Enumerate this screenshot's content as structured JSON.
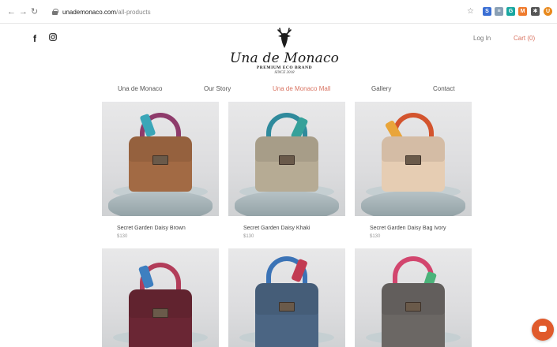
{
  "browser": {
    "url_host": "unademonaco.com",
    "url_path": "/all-products",
    "extensions": [
      {
        "name": "ext-blue-icon",
        "color": "#3b6fd4",
        "glyph": "S"
      },
      {
        "name": "ext-grid-icon",
        "color": "#8aa0b5",
        "glyph": "≡"
      },
      {
        "name": "ext-teal-icon",
        "color": "#19a7a1",
        "glyph": "G"
      },
      {
        "name": "ext-orange-icon",
        "color": "#ef7b2d",
        "glyph": "M"
      },
      {
        "name": "ext-puzzle-icon",
        "color": "#555555",
        "glyph": "✱"
      },
      {
        "name": "profile-avatar-icon",
        "color": "#e8891d",
        "glyph": "U"
      }
    ]
  },
  "header": {
    "logo_name": "Una de Monaco",
    "logo_tagline": "PREMIUM ECO BRAND",
    "logo_since": "SINCE 2018",
    "login_label": "Log In",
    "cart_label": "Cart (0)",
    "accent_color": "#d97462"
  },
  "nav": {
    "items": [
      "Una de Monaco",
      "Our Story",
      "Una de Monaco Mall",
      "Gallery",
      "Contact"
    ],
    "active_index": 2
  },
  "products": [
    {
      "name": "Secret Garden Daisy Brown",
      "price": "$130",
      "color": "#a26a44"
    },
    {
      "name": "Secret Garden Daisy Khaki",
      "price": "$130",
      "color": "#b6ab94"
    },
    {
      "name": "Secret Garden Daisy Bag Ivory",
      "price": "$130",
      "color": "#e6cdb3"
    },
    {
      "name": "",
      "price": "",
      "color": "#6a2634"
    },
    {
      "name": "",
      "price": "",
      "color": "#4b6583"
    },
    {
      "name": "",
      "price": "",
      "color": "#6b6764"
    }
  ]
}
